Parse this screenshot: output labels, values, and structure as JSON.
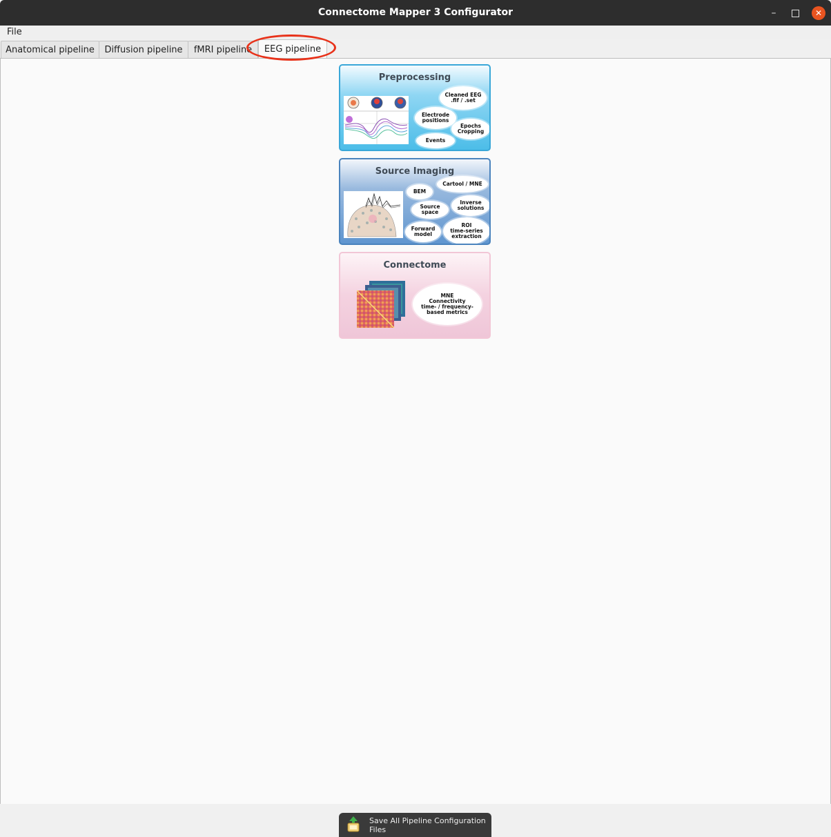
{
  "window": {
    "title": "Connectome Mapper 3 Configurator",
    "minimize_glyph": "–",
    "close_glyph": "✕"
  },
  "menu": {
    "file": "File"
  },
  "tabs": [
    {
      "label": "Anatomical pipeline",
      "active": false
    },
    {
      "label": "Diffusion pipeline",
      "active": false
    },
    {
      "label": "fMRI pipeline",
      "active": false
    },
    {
      "label": "EEG pipeline",
      "active": true
    }
  ],
  "annotation": {
    "color": "#e8321a",
    "shape": "ellipse",
    "target": "EEG pipeline tab"
  },
  "cards": {
    "preprocessing": {
      "title": "Preprocessing",
      "color": "#4cbde8",
      "bubbles": [
        "Cleaned EEG\n.fif / .set",
        "Electrode\npositions",
        "Epochs\nCropping",
        "Events"
      ]
    },
    "source_imaging": {
      "title": "Source Imaging",
      "color": "#5f95cf",
      "bubbles": [
        "Cartool / MNE",
        "BEM",
        "Inverse\nsolutions",
        "Source\nspace",
        "Forward\nmodel",
        "ROI\ntime-series\nextraction"
      ]
    },
    "connectome": {
      "title": "Connectome",
      "color": "#efc6d8",
      "bubbles": [
        "MNE\nConnectivity\ntime- / frequency-\nbased metrics"
      ]
    }
  },
  "footer": {
    "save_button": "Save All Pipeline Configuration Files",
    "save_icon": "save-files-icon"
  }
}
